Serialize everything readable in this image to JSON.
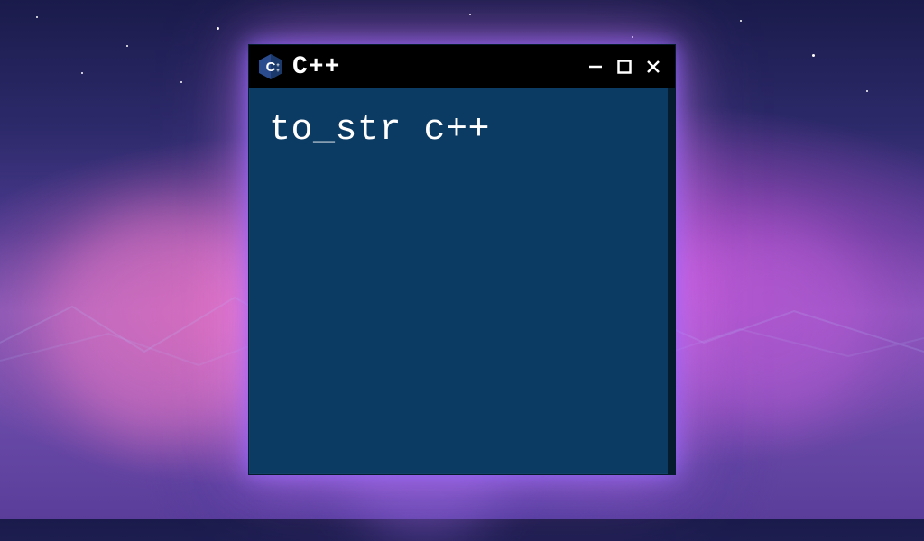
{
  "titlebar": {
    "icon_name": "cpp-icon",
    "title": "C++"
  },
  "content": {
    "code": "to_str c++"
  },
  "colors": {
    "window_bg": "#0b3a63",
    "titlebar_bg": "#000000",
    "text": "#ffffff"
  }
}
